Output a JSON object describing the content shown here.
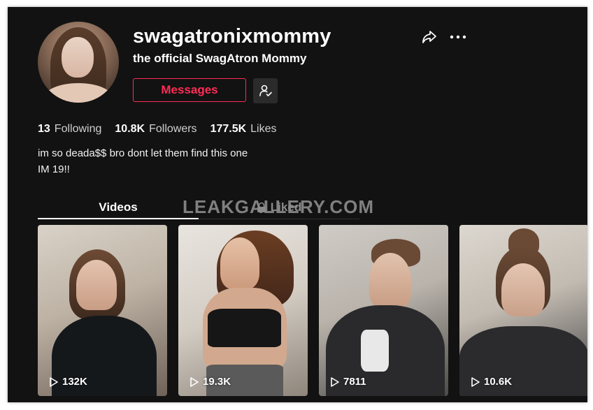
{
  "profile": {
    "username": "swagatronixmommy",
    "nickname": "the official SwagAtron Mommy",
    "messages_label": "Messages"
  },
  "stats": {
    "following_count": "13",
    "following_label": "Following",
    "followers_count": "10.8K",
    "followers_label": "Followers",
    "likes_count": "177.5K",
    "likes_label": "Likes"
  },
  "bio": {
    "line1": "im so deada$$ bro dont let them find this one",
    "line2": "IM 19!!"
  },
  "tabs": {
    "videos": "Videos",
    "liked": "Liked"
  },
  "watermark": "LEAKGALLERY.COM",
  "videos": [
    {
      "plays": "132K"
    },
    {
      "plays": "19.3K"
    },
    {
      "plays": "7811"
    },
    {
      "plays": "10.6K"
    }
  ],
  "colors": {
    "background": "#121212",
    "accent": "#fe2c55",
    "text": "#ffffff"
  },
  "icons": [
    "share-icon",
    "more-icon",
    "follow-user-icon",
    "lock-icon",
    "play-icon"
  ]
}
